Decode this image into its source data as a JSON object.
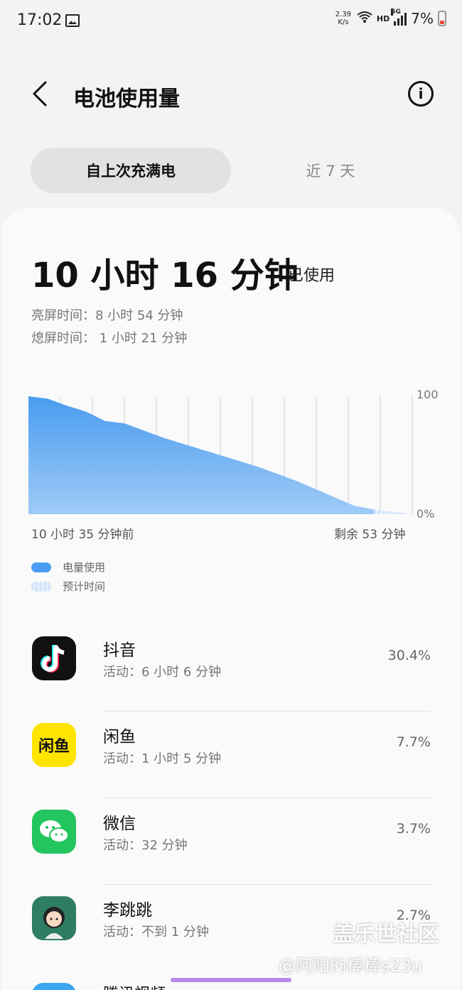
{
  "status_bar": {
    "time": "17:02",
    "net_speed_value": "2.39",
    "net_speed_unit": "K/s",
    "hd": "HD",
    "network": "5G",
    "battery": "7%"
  },
  "header": {
    "title": "电池使用量"
  },
  "tabs": [
    {
      "label": "自上次充满电",
      "active": true
    },
    {
      "label": "近 7 天",
      "active": false
    }
  ],
  "summary": {
    "usage_time": "10 小时 16 分钟",
    "usage_suffix": "已使用",
    "screen_on": "亮屏时间：8 小时 54 分钟",
    "screen_off": "熄屏时间： 1 小时 21 分钟"
  },
  "chart_data": {
    "type": "area",
    "x_start_label": "10 小时 35 分钟前",
    "x_end_label": "剩余 53 分钟",
    "y_tick_top": "100",
    "y_tick_bottom": "0%",
    "ylim": [
      0,
      100
    ],
    "series": [
      {
        "name": "电量使用",
        "x": [
          0,
          5,
          10,
          15,
          20,
          25,
          30,
          35,
          40,
          45,
          50,
          55,
          60,
          65,
          70,
          75,
          80,
          85,
          90
        ],
        "values": [
          100,
          98,
          92,
          87,
          79,
          77,
          71,
          65,
          60,
          55,
          50,
          45,
          40,
          34,
          28,
          21,
          14,
          7,
          4
        ]
      },
      {
        "name": "预计时间",
        "x": [
          90,
          95,
          100
        ],
        "values": [
          4,
          2,
          0
        ]
      }
    ],
    "grid": true,
    "colors": {
      "used": "#4a9cf0",
      "estimated": "#cfe3fa"
    }
  },
  "legend": [
    {
      "label": "电量使用"
    },
    {
      "label": "预计时间"
    }
  ],
  "apps": [
    {
      "name": "抖音",
      "activity": "活动：6 小时 6 分钟",
      "percent": "30.4%",
      "icon": "douyin-icon",
      "icon_text": "♪"
    },
    {
      "name": "闲鱼",
      "activity": "活动：1 小时 5 分钟",
      "percent": "7.7%",
      "icon": "xianyu-icon",
      "icon_text": "闲鱼"
    },
    {
      "name": "微信",
      "activity": "活动：32 分钟",
      "percent": "3.7%",
      "icon": "wechat-icon",
      "icon_text": "••"
    },
    {
      "name": "李跳跳",
      "activity": "活动：不到 1 分钟",
      "percent": "2.7%",
      "icon": "avatar-icon",
      "icon_text": ""
    },
    {
      "name": "腾讯视频"
    }
  ],
  "watermark": {
    "line1": "盖乐世社区",
    "line2": "@阿阳的棒棒s23u"
  }
}
